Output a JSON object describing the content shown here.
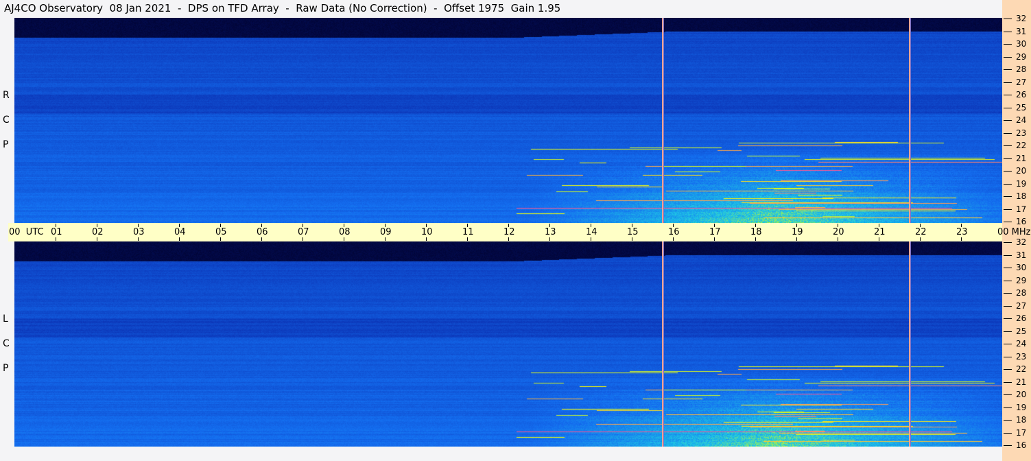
{
  "title": "AJ4CO Observatory  08 Jan 2021  -  DPS on TFD Array  -  Raw Data (No Correction)  -  Offset 1975  Gain 1.95",
  "chart_data": {
    "type": "heatmap",
    "panels": [
      {
        "label": "R C P"
      },
      {
        "label": "L C P"
      }
    ],
    "x_axis": {
      "unit_label": "UTC",
      "range": [
        0,
        24
      ],
      "tick_labels": [
        "00",
        "01",
        "02",
        "03",
        "04",
        "05",
        "06",
        "07",
        "08",
        "09",
        "10",
        "11",
        "12",
        "13",
        "14",
        "15",
        "16",
        "17",
        "18",
        "19",
        "20",
        "21",
        "22",
        "23",
        "00"
      ]
    },
    "y_axis": {
      "unit_label": "MHz",
      "range": [
        16,
        32
      ],
      "tick_labels": [
        "32",
        "31",
        "30",
        "29",
        "28",
        "27",
        "26",
        "25",
        "24",
        "23",
        "22",
        "21",
        "20",
        "19",
        "18",
        "17",
        "16"
      ]
    },
    "markers_utc": [
      15.75,
      21.75
    ],
    "colors": {
      "background_band": "#000000",
      "low": "#0a2aa0",
      "mid": "#1a7af0",
      "high": "#20d0e0",
      "burst": "#ffff00",
      "strong": "#ff40a0",
      "axis_band": "#ffffc6",
      "right_strip": "#fdd9b4"
    }
  }
}
